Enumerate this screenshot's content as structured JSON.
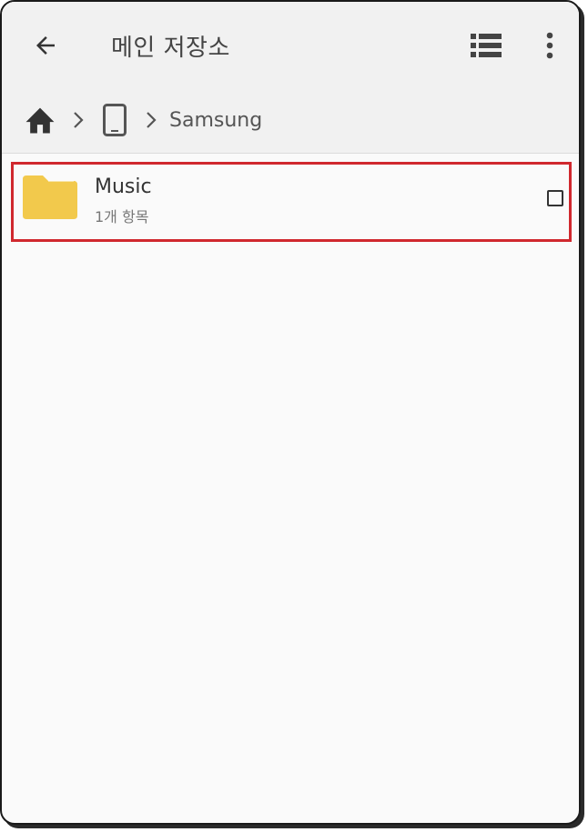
{
  "header": {
    "title": "메인 저장소",
    "icons": {
      "back": "back-arrow-icon",
      "view": "list-view-icon",
      "more": "more-vert-icon"
    }
  },
  "breadcrumb": {
    "items": [
      {
        "icon": "home-icon"
      },
      {
        "icon": "phone-device-icon"
      },
      {
        "label": "Samsung"
      }
    ]
  },
  "files": [
    {
      "name": "Music",
      "subtitle": "1개 항목",
      "icon": "folder-icon",
      "checked": false
    }
  ],
  "colors": {
    "appbar_bg": "#f1f1f1",
    "content_bg": "#fafafa",
    "folder": "#f2c94c",
    "highlight": "#d0282e",
    "icon": "#444444"
  }
}
